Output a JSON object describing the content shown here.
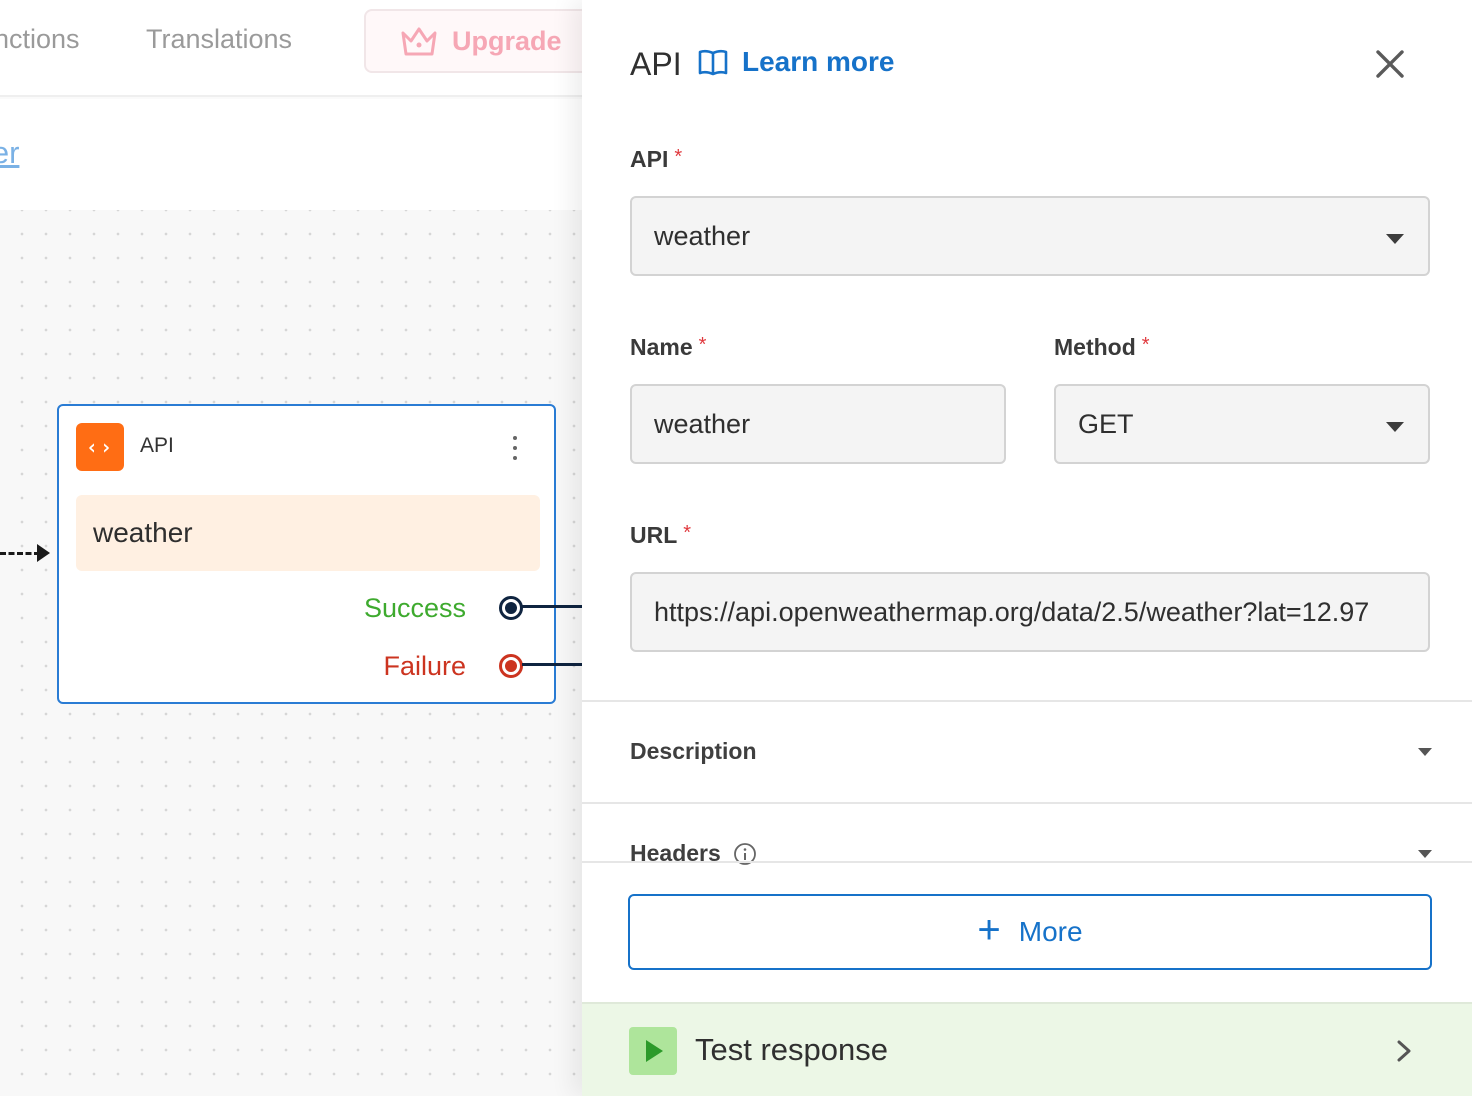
{
  "nav": {
    "functions_label": "nctions",
    "translations_label": "Translations",
    "upgrade_label": "Upgrade"
  },
  "breadcrumb": {
    "link": "ther"
  },
  "node": {
    "type_label": "API",
    "name": "weather",
    "outlets": {
      "success": "Success",
      "failure": "Failure"
    }
  },
  "panel": {
    "title": "API",
    "learn_more": "Learn more",
    "api_field": {
      "label": "API",
      "required_mark": "*",
      "value": "weather"
    },
    "name_field": {
      "label": "Name",
      "required_mark": "*",
      "value": "weather"
    },
    "method_field": {
      "label": "Method",
      "required_mark": "*",
      "value": "GET"
    },
    "url_field": {
      "label": "URL",
      "required_mark": "*",
      "value": "https://api.openweathermap.org/data/2.5/weather?lat=12.97"
    },
    "sections": {
      "description": "Description",
      "headers": "Headers"
    },
    "more_button": "More",
    "test_response": "Test response"
  },
  "colors": {
    "accent_blue": "#1672c9",
    "node_icon_orange": "#ff6d14",
    "success_green": "#3eaa2e",
    "failure_red": "#cc3420",
    "test_bar_bg": "#ecf7e6",
    "upgrade_pink": "#f6a7b5"
  },
  "icons": [
    "crown-icon",
    "code-icon",
    "kebab-menu-icon",
    "book-icon",
    "close-icon",
    "chevron-down-icon",
    "info-icon",
    "plus-icon",
    "play-icon",
    "chevron-right-icon"
  ]
}
